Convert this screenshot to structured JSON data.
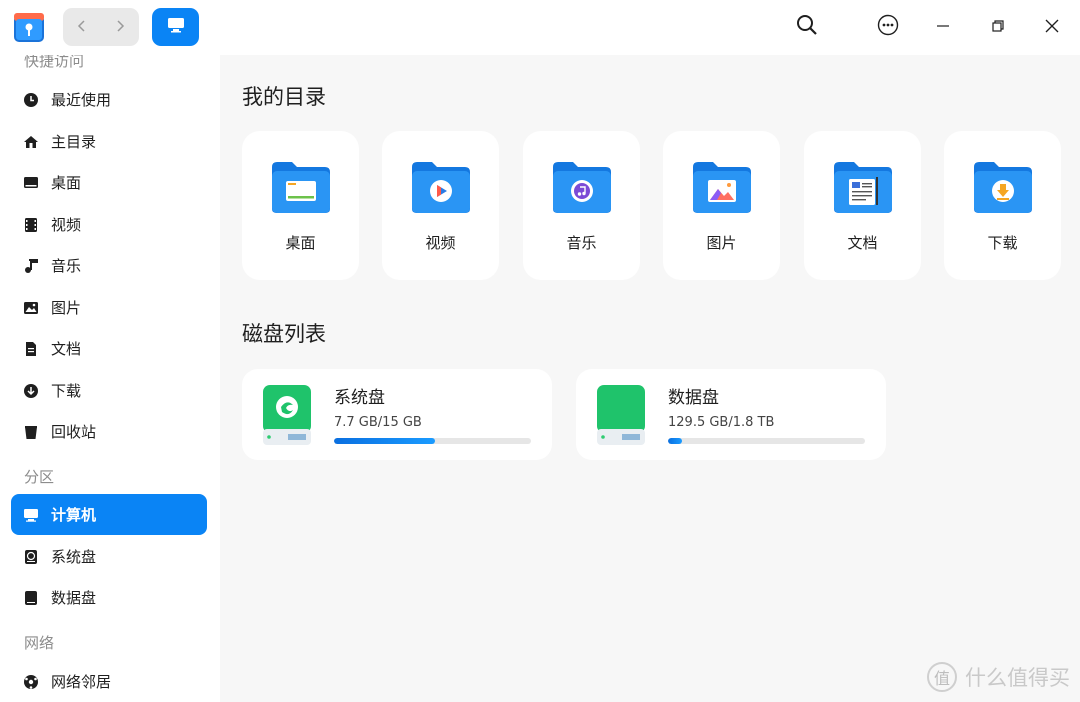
{
  "colors": {
    "accent": "#0a84f5",
    "folder": "#1a8cf0",
    "disk_green": "#1fc36b"
  },
  "toolbar": {
    "back": "‹",
    "forward": "›"
  },
  "sidebar": {
    "sections": {
      "quick": "快捷访问",
      "partition": "分区",
      "network": "网络"
    },
    "quick_items": [
      {
        "label": "最近使用",
        "icon": "clock-icon"
      },
      {
        "label": "主目录",
        "icon": "home-icon"
      },
      {
        "label": "桌面",
        "icon": "desktop-icon"
      },
      {
        "label": "视频",
        "icon": "video-icon"
      },
      {
        "label": "音乐",
        "icon": "music-icon"
      },
      {
        "label": "图片",
        "icon": "picture-icon"
      },
      {
        "label": "文档",
        "icon": "document-icon"
      },
      {
        "label": "下载",
        "icon": "download-icon"
      },
      {
        "label": "回收站",
        "icon": "trash-icon"
      }
    ],
    "partition_items": [
      {
        "label": "计算机",
        "icon": "computer-icon",
        "active": true
      },
      {
        "label": "系统盘",
        "icon": "system-disk-icon"
      },
      {
        "label": "数据盘",
        "icon": "data-disk-icon"
      }
    ],
    "network_items": [
      {
        "label": "网络邻居",
        "icon": "network-icon"
      }
    ]
  },
  "main": {
    "dirs_title": "我的目录",
    "dirs": [
      {
        "label": "桌面",
        "icon": "desktop-folder-icon"
      },
      {
        "label": "视频",
        "icon": "video-folder-icon"
      },
      {
        "label": "音乐",
        "icon": "music-folder-icon"
      },
      {
        "label": "图片",
        "icon": "picture-folder-icon"
      },
      {
        "label": "文档",
        "icon": "document-folder-icon"
      },
      {
        "label": "下载",
        "icon": "download-folder-icon"
      }
    ],
    "disks_title": "磁盘列表",
    "disks": [
      {
        "name": "系统盘",
        "usage": "7.7 GB/15 GB",
        "used_fraction": 0.513
      },
      {
        "name": "数据盘",
        "usage": "129.5 GB/1.8 TB",
        "used_fraction": 0.07
      }
    ]
  },
  "watermark": {
    "text": "什么值得买",
    "logo": "值"
  }
}
